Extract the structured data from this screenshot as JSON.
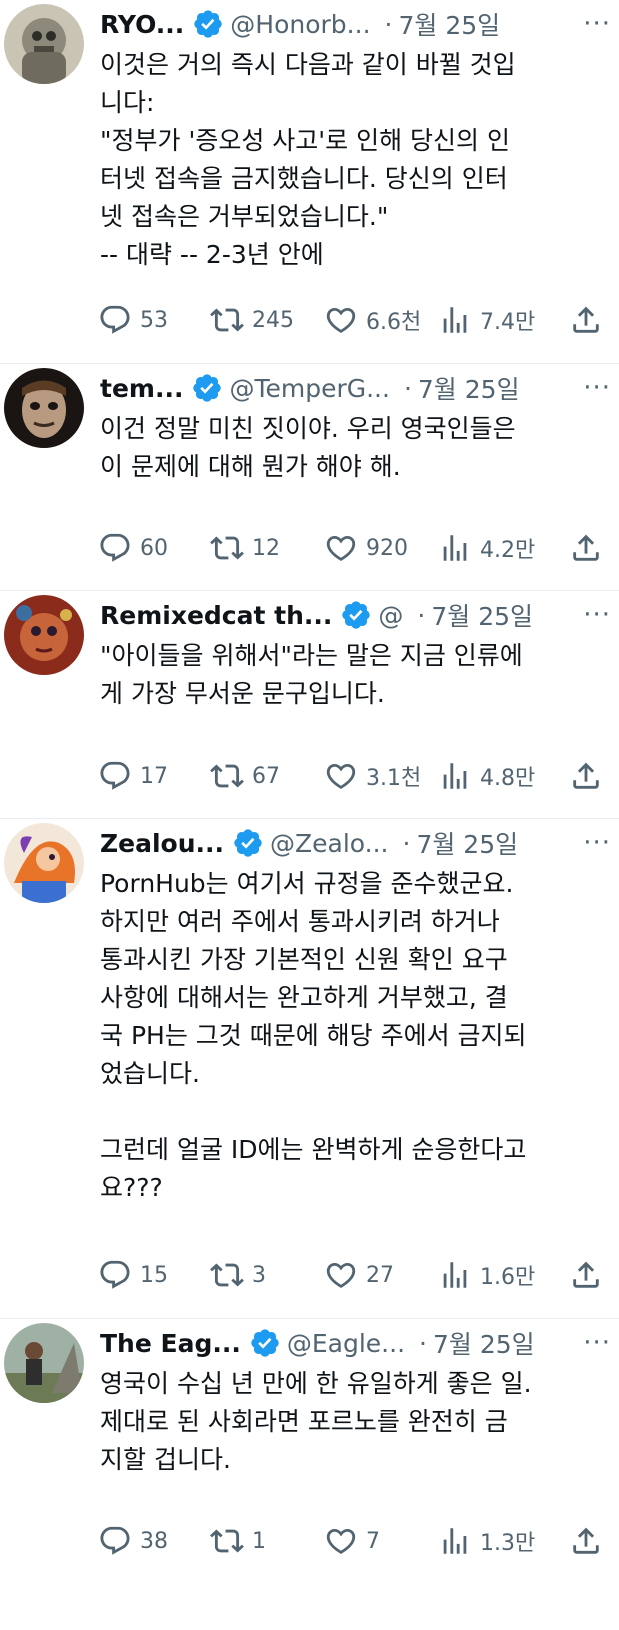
{
  "tweets": [
    {
      "name": "RYO...",
      "handle": "@Honorb...",
      "dot": "·",
      "date": "7월 25일",
      "more": "···",
      "text": "이것은 거의 즉시 다음과 같이 바뀔 것입\n니다:\n\"정부가 '증오성 사고'로 인해 당신의 인\n터넷 접속을 금지했습니다. 당신의 인터\n넷 접속은 거부되었습니다.\"\n-- 대략 -- 2-3년 안에",
      "replies": "53",
      "retweets": "245",
      "likes": "6.6천",
      "views": "7.4만"
    },
    {
      "name": "tem...",
      "handle": "@TemperG...",
      "dot": "·",
      "date": "7월 25일",
      "more": "···",
      "text": "이건 정말 미친 짓이야. 우리 영국인들은\n이 문제에 대해 뭔가 해야 해.",
      "replies": "60",
      "retweets": "12",
      "likes": "920",
      "views": "4.2만"
    },
    {
      "name": "Remixedcat th...",
      "handle": "@",
      "dot": "·",
      "date": "7월 25일",
      "more": "···",
      "text": "\"아이들을 위해서\"라는 말은 지금 인류에\n게 가장 무서운 문구입니다.",
      "replies": "17",
      "retweets": "67",
      "likes": "3.1천",
      "views": "4.8만"
    },
    {
      "name": "Zealou...",
      "handle": "@Zealo...",
      "dot": "·",
      "date": "7월 25일",
      "more": "···",
      "text": "PornHub는 여기서 규정을 준수했군요.\n하지만 여러 주에서 통과시키려 하거나\n통과시킨 가장 기본적인 신원 확인 요구\n사항에 대해서는 완고하게 거부했고, 결\n국 PH는 그것 때문에 해당 주에서 금지되\n었습니다.\n\n그런데 얼굴 ID에는 완벽하게 순응한다고\n요???",
      "replies": "15",
      "retweets": "3",
      "likes": "27",
      "views": "1.6만"
    },
    {
      "name": "The Eag...",
      "handle": "@Eagle...",
      "dot": "·",
      "date": "7월 25일",
      "more": "···",
      "text": "영국이 수십 년 만에 한 유일하게 좋은 일.\n제대로 된 사회라면 포르노를 완전히 금\n지할 겁니다.",
      "replies": "38",
      "retweets": "1",
      "likes": "7",
      "views": "1.3만"
    }
  ],
  "colors": {
    "text": "#0f1419",
    "muted": "#536471",
    "verified": "#1d9bf0",
    "divider": "#e6ecf0"
  },
  "icons": [
    "reply-icon",
    "retweet-icon",
    "like-icon",
    "views-icon",
    "share-icon",
    "verified-badge-icon"
  ]
}
